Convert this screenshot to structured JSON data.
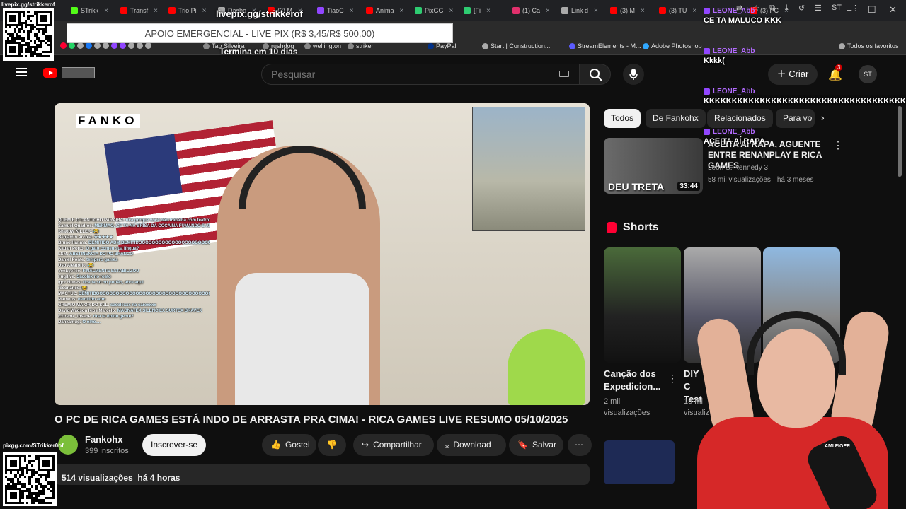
{
  "browser": {
    "tabs": [
      {
        "label": "STrikk",
        "color": "#53fc18"
      },
      {
        "label": "Transf",
        "color": "#ff0000"
      },
      {
        "label": "Trio Pi",
        "color": "#ff0000"
      },
      {
        "label": "Dasbo",
        "color": "#aaaaaa"
      },
      {
        "label": "(3) M",
        "color": "#ff0000"
      },
      {
        "label": "TiaoC",
        "color": "#9146ff"
      },
      {
        "label": "Anima",
        "color": "#ff0000"
      },
      {
        "label": "PixGG",
        "color": "#2ecc71"
      },
      {
        "label": "[Fi",
        "color": "#2ecc71"
      },
      {
        "label": "(1) Ca",
        "color": "#e1306c"
      },
      {
        "label": "Link d",
        "color": "#aaaaaa"
      },
      {
        "label": "(3) M",
        "color": "#ff0000"
      },
      {
        "label": "(3) TU",
        "color": "#ff0000"
      },
      {
        "label": "(3) PC",
        "color": "#ff0000"
      }
    ],
    "bookmarks": [
      {
        "label": "Tap Silveira",
        "color": "#888888"
      },
      {
        "label": "rushdog",
        "color": "#888888"
      },
      {
        "label": "wellington",
        "color": "#888888"
      },
      {
        "label": "striker",
        "color": "#888888"
      },
      {
        "label": "PayPal",
        "color": "#003087"
      },
      {
        "label": "Start | Construction...",
        "color": "#aaaaaa"
      },
      {
        "label": "StreamElements - M...",
        "color": "#5b5bff"
      },
      {
        "label": "Adobe Photoshop",
        "color": "#31a8ff"
      },
      {
        "label": "Todos os favoritos",
        "color": "#aaaaaa"
      }
    ]
  },
  "overlay": {
    "qr_top_label": "livepix.gg/strikkerof",
    "qr_bottom_label": "pixgg.com/STrikker0of",
    "pix_url": "livepix.gg/strikkerof",
    "pix_banner": "APOIO EMERGENCIAL - LIVE PIX (R$ 3,45/R$ 500,00)",
    "pix_timer": "Termina em 10 dias"
  },
  "header": {
    "search_placeholder": "Pesquisar",
    "create_label": "Criar",
    "notifications": "3",
    "avatar_initials": "ST"
  },
  "video": {
    "overlay_brand": "FANKO",
    "title": "O PC DE RICA GAMES ESTÁ INDO DE ARRASTA PRA CIMA! - RICA GAMES LIVE RESUMO 05/10/2025",
    "channel": "Fankohx",
    "subscribers": "399 inscritos",
    "subscribe_label": "Inscrever-se",
    "like_label": "Gostei",
    "share_label": "Compartilhar",
    "download_label": "Download",
    "save_label": "Salvar",
    "views": "514 visualizações",
    "published": "há 4 horas",
    "chat": [
      {
        "user": "QUEM É O CANTICHO PARAIBA:",
        "msg": "rica porque você não trabalha com teatro? ou artes cênicas"
      },
      {
        "user": "Samuel Quadros:",
        "msg": "MERMAO, CE TA NA BRISA DA COCAINA FUMANDO E AINDA TA NA NÓIA RAPA"
      },
      {
        "user": "Shadow KILLER:",
        "msg": "😂"
      },
      {
        "user": "Benjamin Arcola:",
        "msg": "★★★★★"
      },
      {
        "user": "Bruno Hanma:",
        "msg": "DEMITIDO ADM DEMITIDOOOOOOOOOOOOOOOOOOOOOOOOOOO DEMITIDO"
      },
      {
        "user": "Kauan Porto:",
        "msg": "O gato comeu sua língua?"
      },
      {
        "user": "LSM:",
        "msg": "ABSTINENCIA DO PÓ BRANCO"
      },
      {
        "user": "Daniel Ponte:",
        "msg": "tempero games"
      },
      {
        "user": "Uso Aleatório:",
        "msg": "😂"
      },
      {
        "user": "VeeEyeTee:",
        "msg": "FINALMENTE ESTABILIZOU"
      },
      {
        "user": "Fugilive:",
        "msg": "Sacolex no rosto"
      },
      {
        "user": "Igor Nunes:",
        "msg": "rica ta só no portão, abre aqui"
      },
      {
        "user": "resonance:",
        "msg": "😂"
      },
      {
        "user": "MACTUZ:",
        "msg": "DEMITIDOOOOOOOOOOOOOOOOOOOOOOOOOOOOOOOOOOOOO"
      },
      {
        "user": "Matheus:",
        "msg": "demitido adm"
      },
      {
        "user": "GREMIO MAIOR DO SUL:",
        "msg": "sacolexxx na carexxxx"
      },
      {
        "user": "David Wadson Rios Marcelo:",
        "msg": "MAGNATEX SILENCIEX SURTEX BRAVEX"
      },
      {
        "user": "Extreme_Insane:",
        "msg": "rica ta doido gente?"
      },
      {
        "user": "Dankamug:",
        "msg": "O olho...."
      }
    ]
  },
  "sidebar": {
    "chips": [
      {
        "label": "Todos",
        "active": true
      },
      {
        "label": "De Fankohx",
        "active": false
      },
      {
        "label": "Relacionados",
        "active": false
      },
      {
        "label": "Para vo",
        "active": false
      }
    ],
    "recommended": {
      "thumb_text": "DEU TRETA",
      "duration": "33:44",
      "title": "ACEITA AÍ RAPA, AGUENTE ENTRE RENANPLAY E RICA GAMES",
      "channel": "Leon S. Kennedy 3",
      "meta": "58 mil visualizações · há 3 meses"
    },
    "shorts_heading": "Shorts",
    "shorts": [
      {
        "title": "Canção dos Expedicion...",
        "views": "2 mil visualizações"
      },
      {
        "title": "DIY C Test",
        "views": "15 mi visualiz"
      },
      {
        "title": "",
        "views": ""
      }
    ]
  },
  "right_chat": [
    {
      "user": "LEONE_Abb",
      "msg": "CE TA MALUCO KKK"
    },
    {
      "user": "LEONE_Abb",
      "msg": "Kkkk("
    },
    {
      "user": "LEONE_Abb",
      "msg": "KKKKKKKKKKKKKKKKKKKKKKKKKKKKKKKKKKKKK"
    },
    {
      "user": "LEONE_Abb",
      "msg": "ACEITA AÍ RAPA"
    }
  ],
  "webcam": {
    "shirt_text": "AMI FIGER"
  }
}
